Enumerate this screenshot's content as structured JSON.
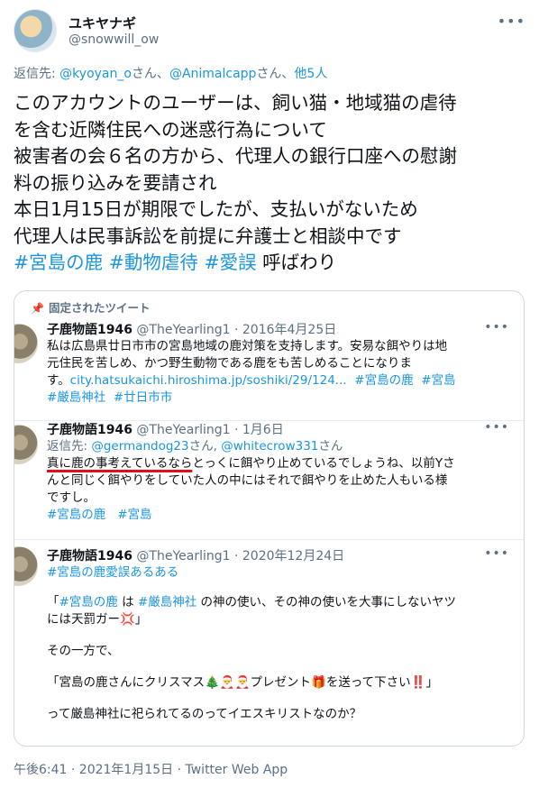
{
  "author": {
    "name": "ユキヤナギ",
    "handle": "@snowwill_ow",
    "more": "•••"
  },
  "reply": {
    "prefix": "返信先: ",
    "user1": "@kyoyan_o",
    "sep1": "さん、",
    "user2": "@Animalcapp",
    "sep2": "さん、",
    "others": "他5人"
  },
  "main": {
    "lines": [
      "このアカウントのユーザーは、飼い猫・地域猫の虐待",
      "を含む近隣住民への迷惑行為について",
      "被害者の会６名の方から、代理人の銀行口座への慰謝",
      "料の振り込みを要請され",
      "本日1月15日が期限でしたが、支払いがないため",
      "代理人は民事訴訟を前提に弁護士と相談中です"
    ],
    "hashtags": [
      "#宮島の鹿",
      "#動物虐待",
      "#愛誤"
    ],
    "tail": "呼ばわり"
  },
  "embed": {
    "pinned_label": "固定されたツイート",
    "tweets": [
      {
        "name": "子鹿物語1946",
        "handle": "@TheYearling1",
        "date": "· 2016年4月25日",
        "more": "•••",
        "lines": [
          "私は広島県廿日市市の宮島地域の鹿対策を支持します。安易な餌やりは地",
          "元住民を苦しめ、かつ野生動物である鹿をも苦しめることになりま"
        ],
        "line3_text": "す。",
        "url": "city.hatsukaichi.hiroshima.jp/soshiki/29/124...",
        "tags": [
          "#宮島の鹿",
          "#宮島",
          "#厳島神社",
          "#廿日市市"
        ]
      },
      {
        "name": "子鹿物語1946",
        "handle": "@TheYearling1",
        "date": "· 1月6日",
        "more": "•••",
        "reply_prefix": "返信先: ",
        "reply_user1": "@germandog23",
        "reply_sep": "さん, ",
        "reply_user2": "@whitecrow331",
        "reply_suffix": "さん",
        "underlined": "真に鹿の事考えているなら",
        "line1_rest": "とっくに餌やり止めているでしょうね、以前Yさ",
        "line2": "んと同じく餌やりをしていた人の中にはそれで餌やりを止めた人もいる様",
        "line3": "ですし。",
        "tags": [
          "#宮島の鹿",
          "#宮島"
        ]
      },
      {
        "name": "子鹿物語1946",
        "handle": "@TheYearling1",
        "date": "· 2020年12月24日",
        "more": "•••",
        "tag_line": "#宮島の鹿愛誤あるある",
        "q1_open": "「",
        "q1_tag1": "#宮島の鹿",
        "q1_mid": " は ",
        "q1_tag2": "#厳島神社",
        "q1_rest": " の神の使い、その神の使いを大事にしないヤツ",
        "q1_line2": "には天罰ガー💢」",
        "para2": "その一方で、",
        "q2": "「宮島の鹿さんにクリスマス🎄🎅🎅プレゼント🎁を送って下さい‼️」",
        "last": "って厳島神社に祀られてるのってイエスキリストなのか？"
      }
    ]
  },
  "footer": "午後6:41 · 2021年1月15日 · Twitter Web App"
}
